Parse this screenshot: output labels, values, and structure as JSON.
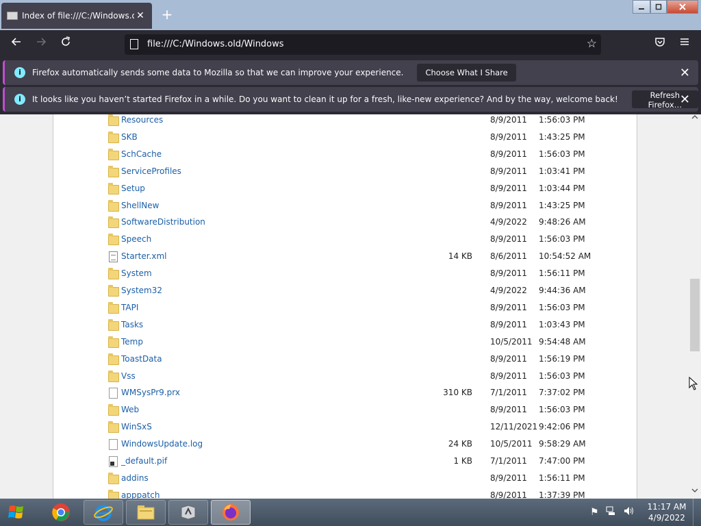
{
  "window": {
    "tab_title": "Index of file:///C:/Windows.old/Windows",
    "new_tab": "+",
    "min": "—",
    "max": "▢",
    "close": "✕"
  },
  "nav": {
    "url": "file:///C:/Windows.old/Windows"
  },
  "notifications": [
    {
      "text": "Firefox automatically sends some data to Mozilla so that we can improve your experience.",
      "button": "Choose What I Share"
    },
    {
      "text": "It looks like you haven’t started Firefox in a while. Do you want to clean it up for a fresh, like-new experience? And by the way, welcome back!",
      "button": "Refresh Firefox…"
    }
  ],
  "files": [
    {
      "name": "Resources",
      "type": "folder",
      "size": "",
      "date": "8/9/2011",
      "time": "1:56:03 PM"
    },
    {
      "name": "SKB",
      "type": "folder",
      "size": "",
      "date": "8/9/2011",
      "time": "1:43:25 PM"
    },
    {
      "name": "SchCache",
      "type": "folder",
      "size": "",
      "date": "8/9/2011",
      "time": "1:56:03 PM"
    },
    {
      "name": "ServiceProfiles",
      "type": "folder",
      "size": "",
      "date": "8/9/2011",
      "time": "1:03:41 PM"
    },
    {
      "name": "Setup",
      "type": "folder",
      "size": "",
      "date": "8/9/2011",
      "time": "1:03:44 PM"
    },
    {
      "name": "ShellNew",
      "type": "folder",
      "size": "",
      "date": "8/9/2011",
      "time": "1:43:25 PM"
    },
    {
      "name": "SoftwareDistribution",
      "type": "folder",
      "size": "",
      "date": "4/9/2022",
      "time": "9:48:26 AM"
    },
    {
      "name": "Speech",
      "type": "folder",
      "size": "",
      "date": "8/9/2011",
      "time": "1:56:03 PM"
    },
    {
      "name": "Starter.xml",
      "type": "xml",
      "size": "14 KB",
      "date": "8/6/2011",
      "time": "10:54:52 AM"
    },
    {
      "name": "System",
      "type": "folder",
      "size": "",
      "date": "8/9/2011",
      "time": "1:56:11 PM"
    },
    {
      "name": "System32",
      "type": "folder",
      "size": "",
      "date": "4/9/2022",
      "time": "9:44:36 AM"
    },
    {
      "name": "TAPI",
      "type": "folder",
      "size": "",
      "date": "8/9/2011",
      "time": "1:56:03 PM"
    },
    {
      "name": "Tasks",
      "type": "folder",
      "size": "",
      "date": "8/9/2011",
      "time": "1:03:43 PM"
    },
    {
      "name": "Temp",
      "type": "folder",
      "size": "",
      "date": "10/5/2011",
      "time": "9:54:48 AM"
    },
    {
      "name": "ToastData",
      "type": "folder",
      "size": "",
      "date": "8/9/2011",
      "time": "1:56:19 PM"
    },
    {
      "name": "Vss",
      "type": "folder",
      "size": "",
      "date": "8/9/2011",
      "time": "1:56:03 PM"
    },
    {
      "name": "WMSysPr9.prx",
      "type": "file",
      "size": "310 KB",
      "date": "7/1/2011",
      "time": "7:37:02 PM"
    },
    {
      "name": "Web",
      "type": "folder",
      "size": "",
      "date": "8/9/2011",
      "time": "1:56:03 PM"
    },
    {
      "name": "WinSxS",
      "type": "folder",
      "size": "",
      "date": "12/11/2021",
      "time": "9:42:06 PM"
    },
    {
      "name": "WindowsUpdate.log",
      "type": "file",
      "size": "24 KB",
      "date": "10/5/2011",
      "time": "9:58:29 AM"
    },
    {
      "name": "_default.pif",
      "type": "pif",
      "size": "1 KB",
      "date": "7/1/2011",
      "time": "7:47:00 PM"
    },
    {
      "name": "addins",
      "type": "folder",
      "size": "",
      "date": "8/9/2011",
      "time": "1:56:11 PM"
    },
    {
      "name": "apppatch",
      "type": "folder",
      "size": "",
      "date": "8/9/2011",
      "time": "1:37:39 PM"
    }
  ],
  "taskbar": {
    "clock_time": "11:17 AM",
    "clock_date": "4/9/2022"
  },
  "icons": {
    "tab": "page-icon",
    "back": "arrow-left-icon",
    "forward": "arrow-right-icon",
    "reload": "reload-icon",
    "star": "star-icon",
    "pocket": "pocket-icon",
    "menu": "hamburger-menu-icon",
    "info": "info-icon",
    "folder": "folder-icon",
    "file": "file-icon"
  },
  "colors": {
    "link": "#1b5fa8",
    "toolbar": "#2b2a33",
    "notification": "#42414d",
    "notification_accent": "#c04ed0"
  }
}
